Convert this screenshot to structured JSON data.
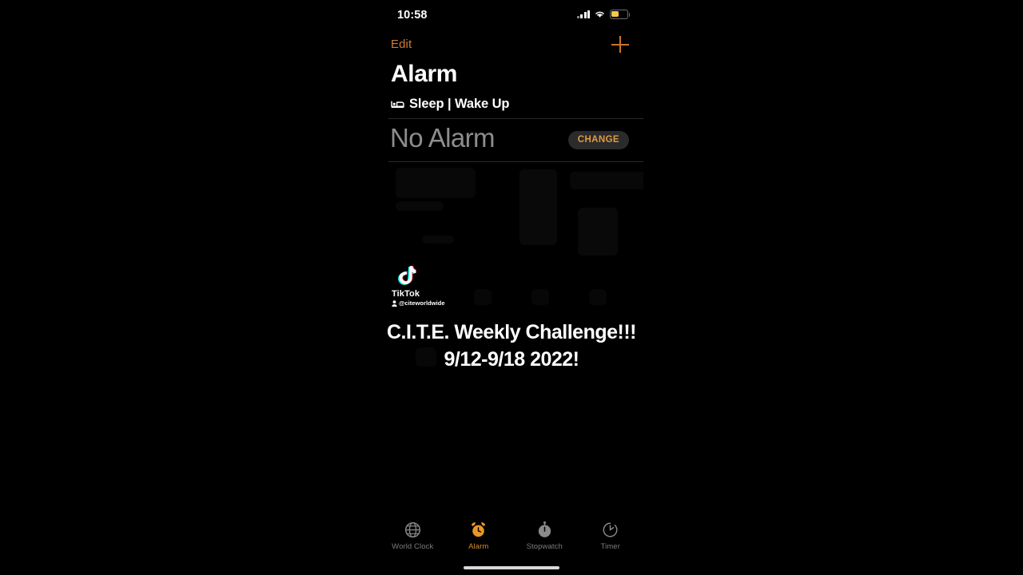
{
  "status_bar": {
    "time": "10:58",
    "cellular_icon": "cellular-signal-icon",
    "wifi_icon": "wifi-icon",
    "battery_icon": "battery-low-icon",
    "battery_color": "#f7c948"
  },
  "nav": {
    "edit_label": "Edit",
    "add_icon": "plus-icon",
    "accent_color": "#d07d2e"
  },
  "header": {
    "title": "Alarm"
  },
  "sleep_section": {
    "icon": "bed-icon",
    "label": "Sleep | Wake Up",
    "alarm_value": "No Alarm",
    "change_label": "CHANGE",
    "change_text_color": "#e09a3e",
    "change_bg_color": "#2b2b2d"
  },
  "watermark": {
    "logo_icon": "tiktok-logo-icon",
    "brand": "TikTok",
    "person_icon": "person-icon",
    "handle": "@citeworldwide"
  },
  "caption": {
    "line1": "C.I.T.E. Weekly Challenge!!!",
    "line2": "9/12-9/18 2022!"
  },
  "tab_bar": {
    "active_color": "#d98b2b",
    "inactive_color": "#7c7c80",
    "tabs": [
      {
        "id": "world-clock",
        "label": "World Clock",
        "icon": "globe-icon",
        "active": false
      },
      {
        "id": "alarm",
        "label": "Alarm",
        "icon": "alarm-clock-icon",
        "active": true
      },
      {
        "id": "stopwatch",
        "label": "Stopwatch",
        "icon": "stopwatch-icon",
        "active": false
      },
      {
        "id": "timer",
        "label": "Timer",
        "icon": "timer-icon",
        "active": false
      }
    ]
  },
  "home_indicator": {
    "present": true
  }
}
